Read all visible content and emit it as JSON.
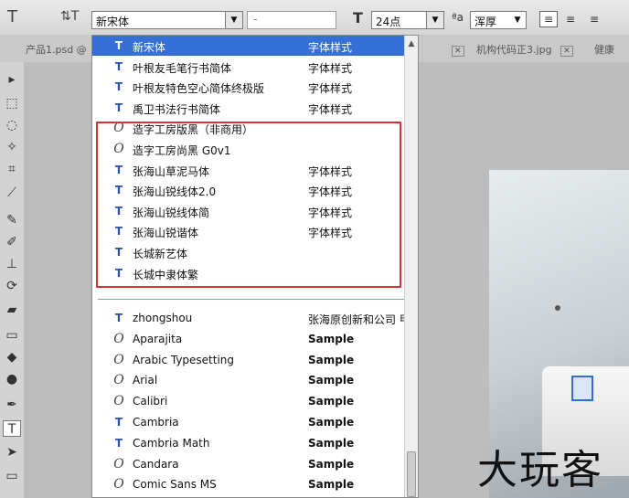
{
  "options_bar": {
    "font_family_value": "新宋体",
    "font_style_value": "-",
    "font_size_value": "24点",
    "antialias_value": "浑厚"
  },
  "tabs": [
    {
      "label": "产品1.psd @"
    },
    {
      "label": "机构代码正3.jpg"
    },
    {
      "label": "健康"
    }
  ],
  "font_list": {
    "selected_index": 0,
    "fonts": [
      {
        "name": "新宋体",
        "sample": "字体样式",
        "type": "tt"
      },
      {
        "name": "叶根友毛笔行书简体",
        "sample": "字体样式",
        "type": "tt"
      },
      {
        "name": "叶根友特色空心简体终极版",
        "sample": "字体样式",
        "type": "tt"
      },
      {
        "name": "禹卫书法行书简体",
        "sample": "字体样式",
        "type": "tt"
      },
      {
        "name": "造字工房版黑（非商用）",
        "sample": "",
        "type": "otf"
      },
      {
        "name": "造字工房尚黑 G0v1",
        "sample": "",
        "type": "otf"
      },
      {
        "name": "张海山草泥马体",
        "sample": "字体样式",
        "type": "tt"
      },
      {
        "name": "张海山锐线体2.0",
        "sample": "字体样式",
        "type": "tt"
      },
      {
        "name": "张海山锐线体简",
        "sample": "字体样式",
        "type": "tt"
      },
      {
        "name": "张海山锐谐体",
        "sample": "字体样式",
        "type": "tt"
      },
      {
        "name": "长城新艺体",
        "sample": "",
        "type": "tt"
      },
      {
        "name": "长城中隶体繁",
        "sample": "",
        "type": "tt"
      },
      {
        "name": "zhongshou",
        "sample": "张海原创新和公司 甲",
        "type": "tt"
      },
      {
        "name": "Aparajita",
        "sample": "Sample",
        "type": "otf"
      },
      {
        "name": "Arabic Typesetting",
        "sample": "Sample",
        "type": "otf"
      },
      {
        "name": "Arial",
        "sample": "Sample",
        "type": "otf"
      },
      {
        "name": "Calibri",
        "sample": "Sample",
        "type": "otf"
      },
      {
        "name": "Cambria",
        "sample": "Sample",
        "type": "tt"
      },
      {
        "name": "Cambria Math",
        "sample": "Sample",
        "type": "tt"
      },
      {
        "name": "Candara",
        "sample": "Sample",
        "type": "otf"
      },
      {
        "name": "Comic Sans MS",
        "sample": "Sample",
        "type": "otf"
      }
    ]
  },
  "watermark": "大玩客",
  "colors": {
    "selection": "#3670d6",
    "highlight_border": "#d9333c",
    "separator": "#6aa6c8"
  }
}
